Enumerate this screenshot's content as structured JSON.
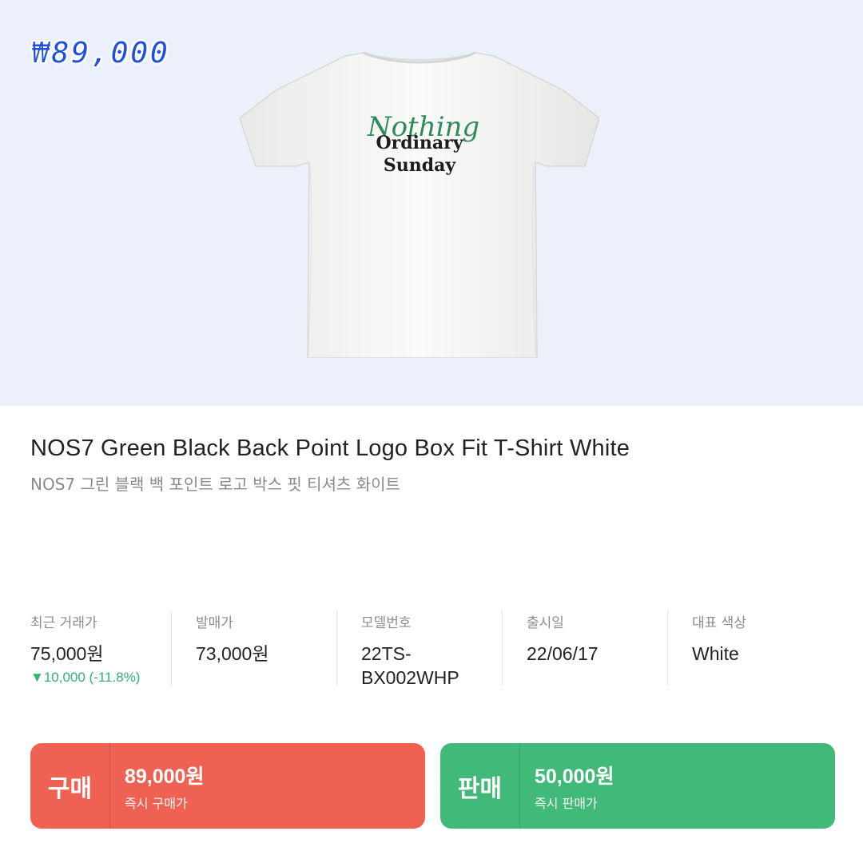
{
  "hero": {
    "price_tag": "₩89,000",
    "shirt_print": {
      "script": "Nothing",
      "line1": "Ordinary",
      "line2": "Sunday"
    },
    "colors": {
      "background": "#ebf0fb",
      "shirt": "#f7f7f5",
      "script": "#2e8b5c",
      "print": "#1c1c1c"
    }
  },
  "product": {
    "title_en": "NOS7 Green Black Back Point Logo Box Fit T-Shirt White",
    "title_ko": "NOS7 그린 블랙 백 포인트 로고 박스 핏 티셔츠 화이트"
  },
  "info": [
    {
      "label": "최근 거래가",
      "value": "75,000원",
      "change": "▼10,000 (-11.8%)"
    },
    {
      "label": "발매가",
      "value": "73,000원"
    },
    {
      "label": "모델번호",
      "value": "22TS-\nBX002WHP"
    },
    {
      "label": "출시일",
      "value": "22/06/17"
    },
    {
      "label": "대표 색상",
      "value": "White"
    }
  ],
  "buttons": {
    "buy": {
      "kind": "구매",
      "price": "89,000원",
      "sub": "즉시 구매가",
      "color": "#ef6253"
    },
    "sell": {
      "kind": "판매",
      "price": "50,000원",
      "sub": "즉시 판매가",
      "color": "#41b979"
    }
  }
}
